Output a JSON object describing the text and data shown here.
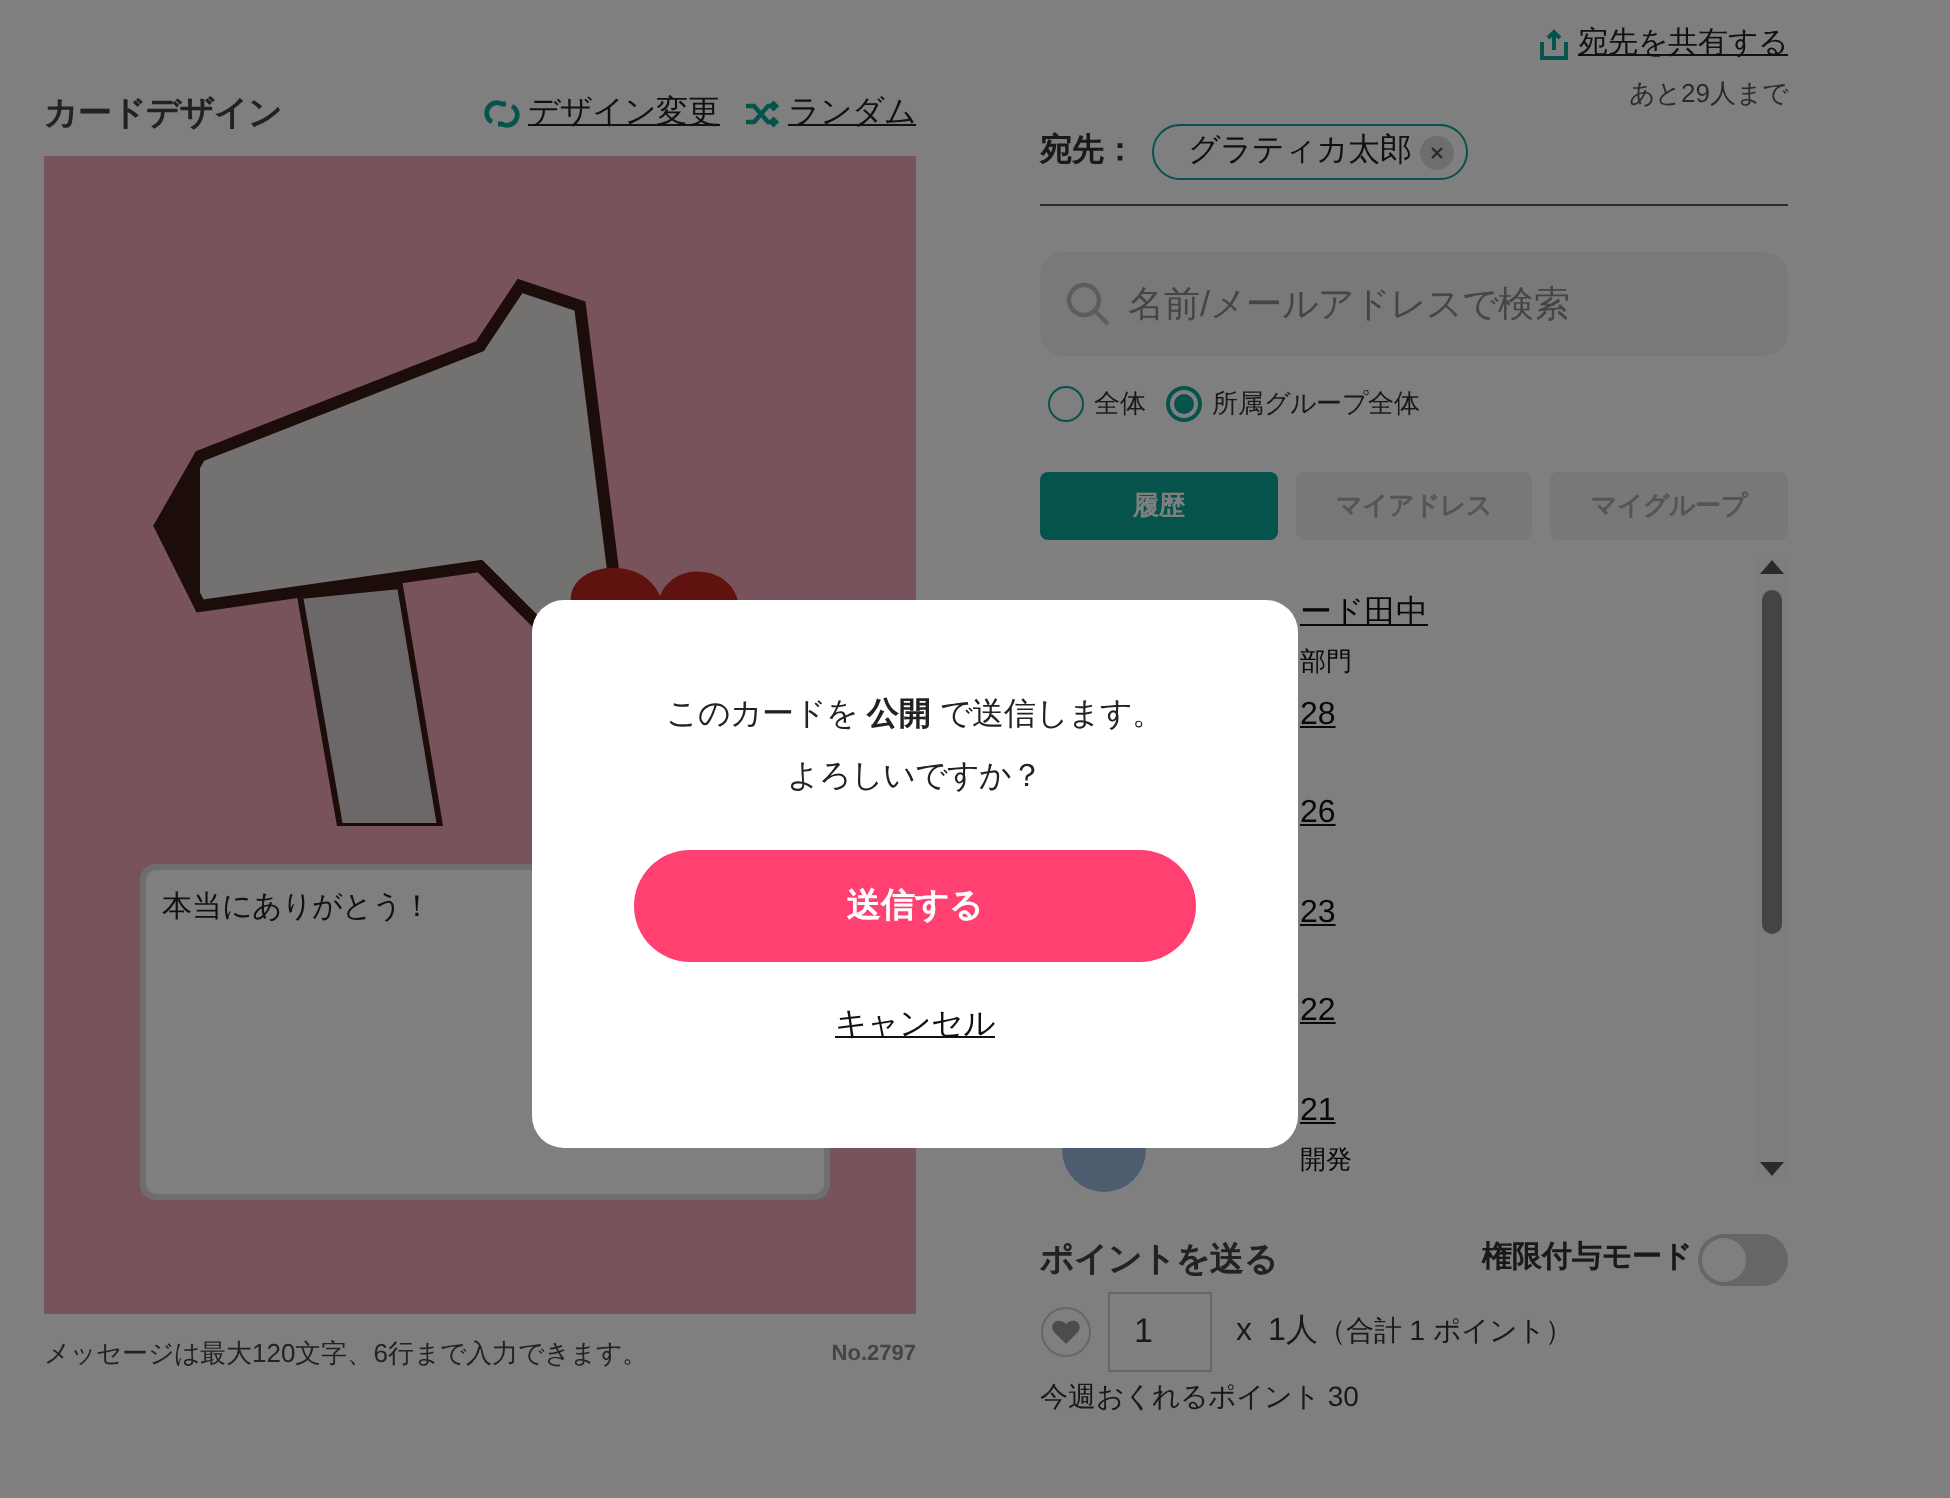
{
  "design": {
    "title": "カードデザイン",
    "links": [
      {
        "kind": "change",
        "label": "デザイン変更"
      },
      {
        "kind": "random",
        "label": "ランダム"
      }
    ],
    "message": {
      "value": "本当にありがとう！"
    },
    "caption": "メッセージは最大120文字、6行まで入力できます。",
    "number": "No.2797"
  },
  "share": {
    "label": "宛先を共有する",
    "remaining": "あと29人まで"
  },
  "recipients": {
    "label": "宛先：",
    "chips": [
      {
        "name": "グラティカ太郎"
      }
    ]
  },
  "search": {
    "placeholder": "名前/メールアドレスで検索"
  },
  "scope": [
    {
      "label": "全体",
      "selected": false
    },
    {
      "label": "所属グループ全体",
      "selected": true
    }
  ],
  "tabs": [
    {
      "label": "履歴",
      "selected": true
    },
    {
      "label": "マイアドレス",
      "selected": false
    },
    {
      "label": "マイグループ",
      "selected": false
    }
  ],
  "list": [
    {
      "name": "ード田中",
      "department": "部門",
      "avatar": false
    },
    {
      "name": "28"
    },
    {
      "name": "26"
    },
    {
      "name": "23"
    },
    {
      "name": "22"
    },
    {
      "name": "21",
      "department": "開発",
      "avatar": true
    }
  ],
  "points": {
    "title": "ポイントを送る",
    "mode": {
      "label": "権限付与モード",
      "on": false
    },
    "amount": {
      "value": "1"
    },
    "times": "x",
    "people": "1人",
    "total": "（合計 1 ポイント）",
    "weekly": "今週おくれるポイント 30"
  },
  "dialog": {
    "message": "このカードを **公開** で送信します。",
    "question": "よろしいですか？",
    "confirm": "送信する",
    "cancel": "キャンセル"
  }
}
